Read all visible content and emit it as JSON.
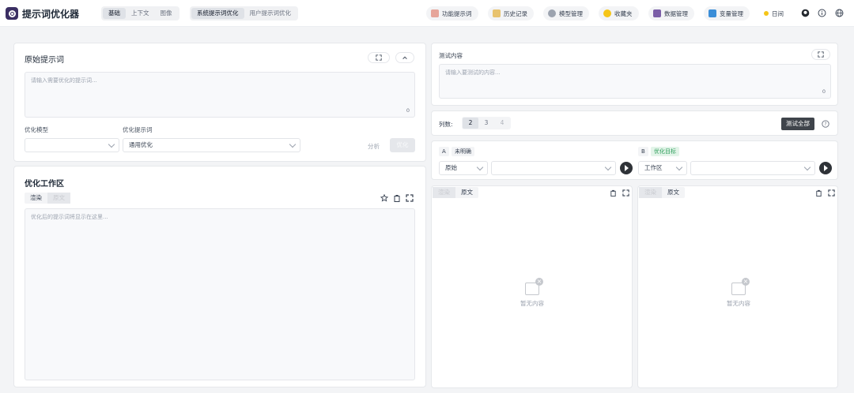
{
  "app": {
    "title": "提示词优化器"
  },
  "mode_tabs": [
    "基础",
    "上下文",
    "图像"
  ],
  "sub_tabs": [
    "系统提示词优化",
    "用户提示词优化"
  ],
  "toolbar": {
    "function_prompt": "功能提示词",
    "history": "历史记录",
    "model_mgmt": "模型管理",
    "favorites": "收藏夹",
    "data_mgmt": "数据管理",
    "var_mgmt": "变量管理",
    "theme": "日间"
  },
  "original": {
    "title": "原始提示词",
    "placeholder": "请输入需要优化的提示词...",
    "count": "0",
    "model_label": "优化模型",
    "prompt_label": "优化提示词",
    "prompt_value": "通用优化",
    "analyze": "分析",
    "optimize": "优化"
  },
  "workspace": {
    "title": "优化工作区",
    "tab_render": "渲染",
    "tab_source": "原文",
    "placeholder": "优化后的提示词将显示在这里..."
  },
  "test": {
    "title": "测试内容",
    "placeholder": "请输入要测试的内容...",
    "count": "0",
    "columns_label": "列数:",
    "columns": [
      "2",
      "3",
      "4"
    ],
    "test_all": "测试全部"
  },
  "col_a": {
    "letter": "A",
    "tag": "未明确",
    "select": "原始",
    "tab_render": "渲染",
    "tab_source": "原文",
    "empty": "暂无内容"
  },
  "col_b": {
    "letter": "B",
    "tag": "优化目标",
    "select": "工作区",
    "tab_render": "渲染",
    "tab_source": "原文",
    "empty": "暂无内容"
  }
}
